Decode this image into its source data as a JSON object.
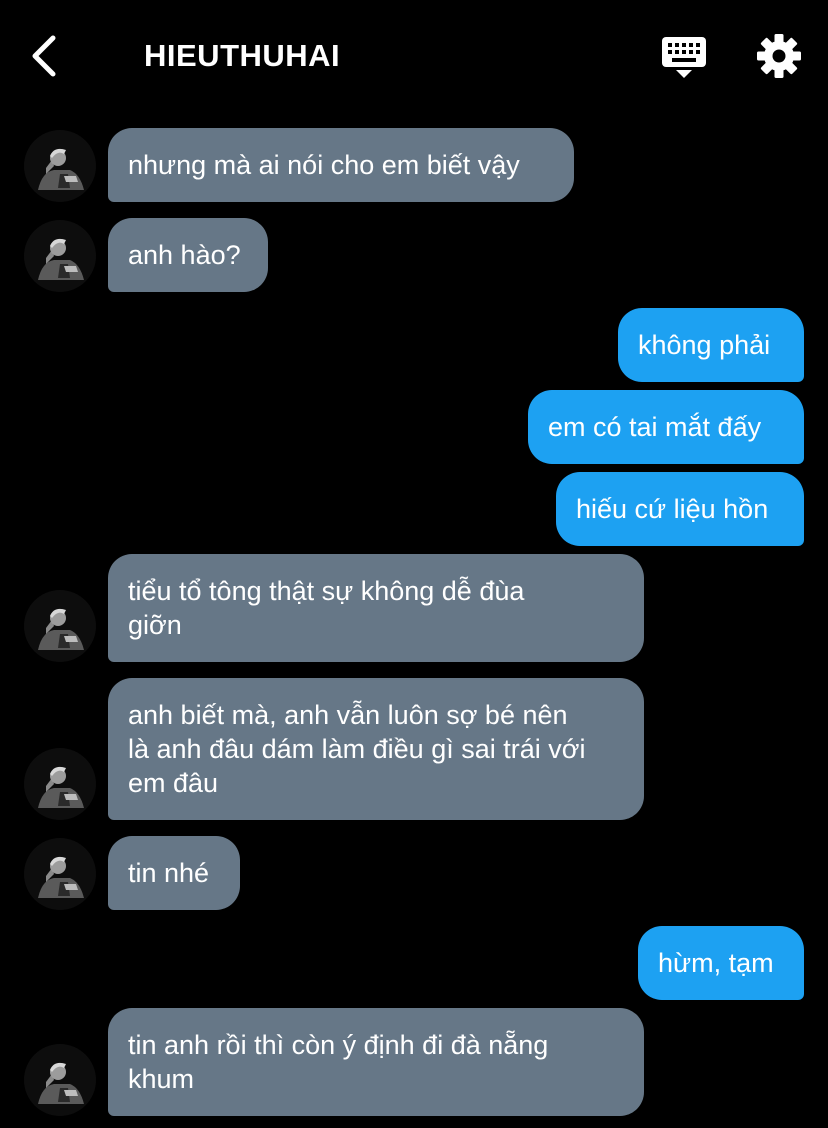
{
  "header": {
    "title": "HIEUTHUHAI",
    "back_icon": "chevron-left-icon",
    "keyboard_icon": "keyboard-icon",
    "settings_icon": "gear-icon"
  },
  "colors": {
    "background": "#000000",
    "incoming_bubble": "#667787",
    "outgoing_bubble": "#1da1f2",
    "text": "#ffffff"
  },
  "messages": [
    {
      "dir": "in",
      "text": "nhưng mà ai nói cho em biết vậy"
    },
    {
      "dir": "in",
      "text": "anh hào?"
    },
    {
      "dir": "out",
      "text": "không phải"
    },
    {
      "dir": "out",
      "text": "em có tai mắt đấy"
    },
    {
      "dir": "out",
      "text": "hiếu cứ liệu hồn"
    },
    {
      "dir": "in",
      "text": "tiểu tổ tông thật sự không dễ đùa\ngiỡn"
    },
    {
      "dir": "in",
      "text": "anh biết mà, anh vẫn luôn sợ bé nên\nlà anh đâu dám làm điều gì sai trái với\nem đâu"
    },
    {
      "dir": "in",
      "text": "tin nhé"
    },
    {
      "dir": "out",
      "text": "hừm, tạm"
    },
    {
      "dir": "in",
      "text": "tin anh rồi thì còn ý định đi đà nẵng\nkhum"
    }
  ]
}
